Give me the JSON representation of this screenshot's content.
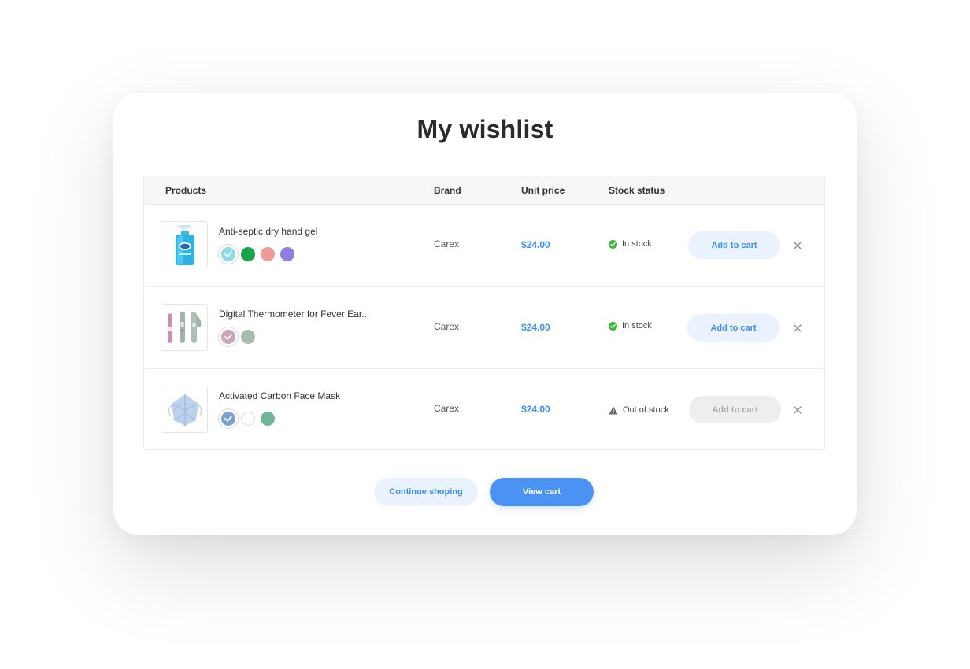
{
  "page": {
    "title": "My wishlist"
  },
  "table": {
    "headers": {
      "products": "Products",
      "brand": "Brand",
      "unit_price": "Unit price",
      "stock_status": "Stock status"
    },
    "rows": [
      {
        "name": "Anti-septic dry hand gel",
        "brand": "Carex",
        "price": "$24.00",
        "stock": "In stock",
        "stock_icon": "check-circle-icon",
        "button": "Add to cart",
        "button_enabled": true,
        "thumbnail": "hand-gel-bottle",
        "swatches": [
          "#8fdbe3",
          "#1aa34a",
          "#f09a9a",
          "#8b7fe0"
        ],
        "selected_swatch": 0
      },
      {
        "name": "Digital Thermometer for Fever Ear...",
        "brand": "Carex",
        "price": "$24.00",
        "stock": "In stock",
        "stock_icon": "check-circle-icon",
        "button": "Add to cart",
        "button_enabled": true,
        "thumbnail": "thermometers",
        "swatches": [
          "#c9a6b8",
          "#a9b9ad"
        ],
        "selected_swatch": 0
      },
      {
        "name": "Activated Carbon Face Mask",
        "brand": "Carex",
        "price": "$24.00",
        "stock": "Out of stock",
        "stock_icon": "warning-icon",
        "button": "Add to cart",
        "button_enabled": false,
        "thumbnail": "face-mask",
        "swatches": [
          "#7fa3cf",
          "#ffffff",
          "#6fb59a"
        ],
        "selected_swatch": 0
      }
    ]
  },
  "actions": {
    "continue_label": "Continue shoping",
    "view_cart_label": "View cart"
  },
  "colors": {
    "accent": "#3b8ef5",
    "in_stock": "#3db83d",
    "warning": "#666666"
  }
}
